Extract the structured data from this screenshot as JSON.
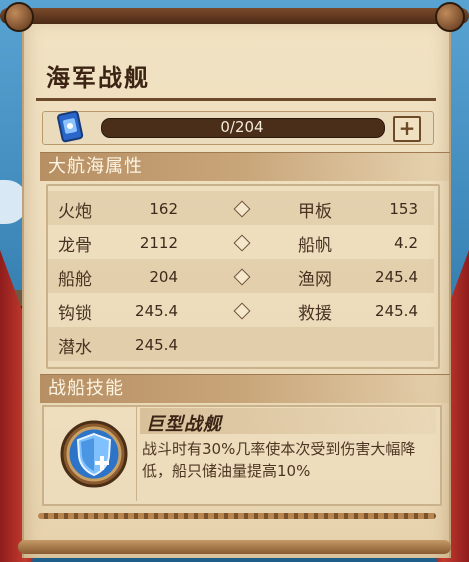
{
  "panel": {
    "title": "海军战舰"
  },
  "resource": {
    "progress_text": "0/204",
    "progress_fraction": 0.0,
    "add_label": "+"
  },
  "attributes_section": {
    "title": "大航海属性"
  },
  "attributes": [
    {
      "left_label": "火炮",
      "left_value": "162",
      "right_label": "甲板",
      "right_value": "153"
    },
    {
      "left_label": "龙骨",
      "left_value": "2112",
      "right_label": "船帆",
      "right_value": "4.2"
    },
    {
      "left_label": "船舱",
      "left_value": "204",
      "right_label": "渔网",
      "right_value": "245.4"
    },
    {
      "left_label": "钩锁",
      "left_value": "245.4",
      "right_label": "救援",
      "right_value": "245.4"
    },
    {
      "left_label": "潜水",
      "left_value": "245.4"
    }
  ],
  "skills_section": {
    "title": "战船技能"
  },
  "skill": {
    "name": "巨型战舰",
    "description": "战斗时有30%几率使本次受到伤害大幅降低，船只储油量提高10%",
    "icon": "shield-plus-icon"
  },
  "colors": {
    "accent": "#3c2414",
    "paper": "#ecdcbb",
    "header": "#c9a67a"
  }
}
